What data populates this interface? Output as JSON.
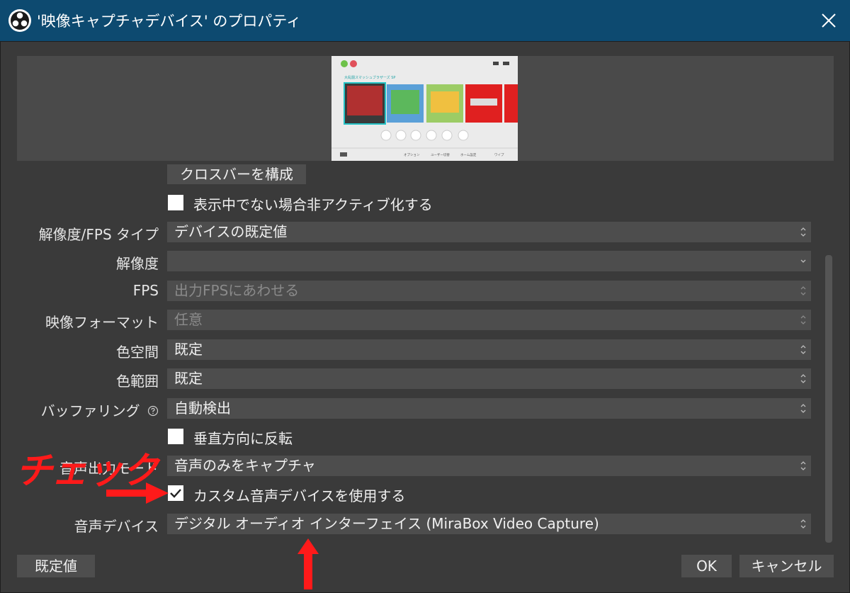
{
  "window": {
    "title": "'映像キャプチャデバイス' のプロパティ",
    "close_glyph": "✕"
  },
  "preview": {
    "header_text": "大乱闘スマッシュブラザーズ SP",
    "footer_items": [
      "オプション",
      "ユーザー切替",
      "ホーム設定",
      "ワイプ"
    ]
  },
  "settings": {
    "crossbar_button": "クロスバーを構成",
    "deactivate_checkbox": {
      "label": "表示中でない場合非アクティブ化する",
      "checked": false
    },
    "resolution_fps_type": {
      "label": "解像度/FPS タイプ",
      "value": "デバイスの既定値"
    },
    "resolution": {
      "label": "解像度",
      "value": ""
    },
    "fps": {
      "label": "FPS",
      "value": "出力FPSにあわせる"
    },
    "video_format": {
      "label": "映像フォーマット",
      "value": "任意"
    },
    "color_space": {
      "label": "色空間",
      "value": "既定"
    },
    "color_range": {
      "label": "色範囲",
      "value": "既定"
    },
    "buffering": {
      "label": "バッファリング",
      "value": "自動検出"
    },
    "flip_checkbox": {
      "label": "垂直方向に反転",
      "checked": false
    },
    "audio_output_mode": {
      "label": "音声出力モード",
      "value": "音声のみをキャプチャ"
    },
    "custom_audio_checkbox": {
      "label": "カスタム音声デバイスを使用する",
      "checked": true
    },
    "audio_device": {
      "label": "音声デバイス",
      "value": "デジタル オーディオ インターフェイス (MiraBox Video Capture)"
    }
  },
  "buttons": {
    "defaults": "既定値",
    "ok": "OK",
    "cancel": "キャンセル"
  },
  "annotation": {
    "text": "チェック",
    "color": "#ff1a1a"
  }
}
